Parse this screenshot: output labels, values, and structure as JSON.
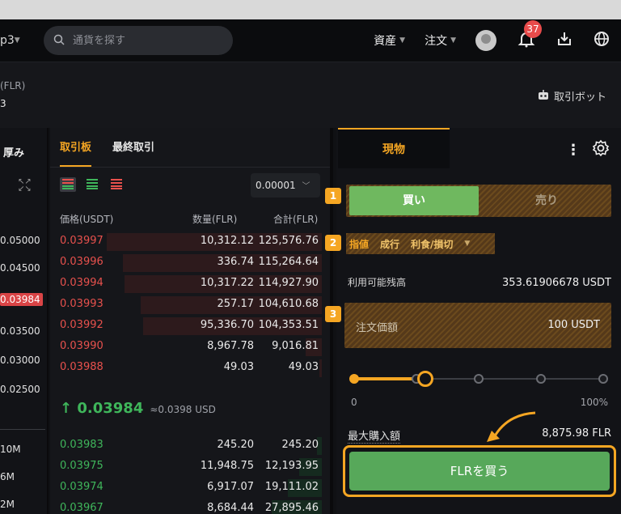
{
  "nav": {
    "pair_fragment": "p3",
    "search_placeholder": "通貨を探す",
    "assets_label": "資産",
    "orders_label": "注文",
    "notification_count": "37"
  },
  "subheader": {
    "pair_name": "(FLR)",
    "pair_value": "3",
    "bot_label": "取引ボット"
  },
  "depth_panel": {
    "title": "厚み",
    "prices": [
      "0.05000",
      "0.04500",
      "0.03984",
      "0.03500",
      "0.03000",
      "0.02500"
    ],
    "active_price": "0.03984",
    "depth_labels": [
      "10M",
      "6M",
      "2M"
    ]
  },
  "orderbook": {
    "tabs": [
      "取引板",
      "最終取引"
    ],
    "precision": "0.00001",
    "col_price": "価格(USDT)",
    "col_qty": "数量(FLR)",
    "col_total": "合計(FLR)",
    "asks": [
      {
        "price": "0.03997",
        "qty": "10,312.12",
        "total": "125,576.76",
        "depth": 0.95
      },
      {
        "price": "0.03996",
        "qty": "336.74",
        "total": "115,264.64",
        "depth": 0.88
      },
      {
        "price": "0.03994",
        "qty": "10,317.22",
        "total": "114,927.90",
        "depth": 0.87
      },
      {
        "price": "0.03993",
        "qty": "257.17",
        "total": "104,610.68",
        "depth": 0.8
      },
      {
        "price": "0.03992",
        "qty": "95,336.70",
        "total": "104,353.51",
        "depth": 0.79
      },
      {
        "price": "0.03990",
        "qty": "8,967.78",
        "total": "9,016.81",
        "depth": 0.07
      },
      {
        "price": "0.03988",
        "qty": "49.03",
        "total": "49.03",
        "depth": 0.01
      }
    ],
    "last_price": "0.03984",
    "last_price_usd": "≈0.0398 USD",
    "bids": [
      {
        "price": "0.03983",
        "qty": "245.20",
        "total": "245.20",
        "depth": 0.02
      },
      {
        "price": "0.03975",
        "qty": "11,948.75",
        "total": "12,193.95",
        "depth": 0.1
      },
      {
        "price": "0.03974",
        "qty": "6,917.07",
        "total": "19,111.02",
        "depth": 0.15
      },
      {
        "price": "0.03967",
        "qty": "8,684.44",
        "total": "27,895.46",
        "depth": 0.22
      }
    ]
  },
  "trade": {
    "tab_spot": "現物",
    "buy_label": "買い",
    "sell_label": "売り",
    "order_types": [
      "指値",
      "成行",
      "利食/損切"
    ],
    "available_label": "利用可能残高",
    "available_value": "353.61906678 USDT",
    "price_label": "注文価額",
    "price_value": "100 USDT",
    "slider_min": "0",
    "slider_max": "100%",
    "slider_percent": 25,
    "max_buy_label": "最大購入額",
    "max_buy_value": "8,875.98 FLR",
    "buy_button": "FLRを買う",
    "markers": [
      "1",
      "2",
      "3"
    ]
  }
}
